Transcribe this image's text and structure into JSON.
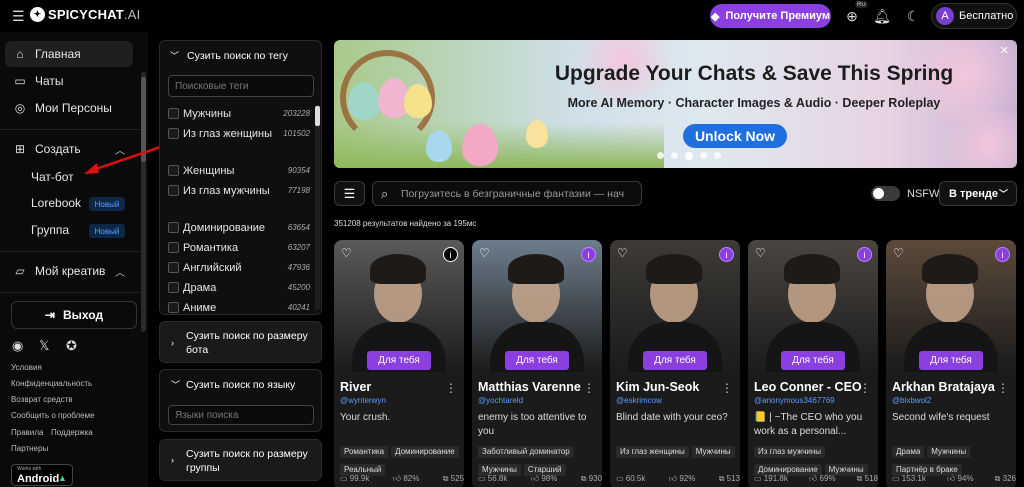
{
  "brand": {
    "name": "SPICYCHAT",
    "suffix": ".AI"
  },
  "header": {
    "premium_label": "Получите Премиум",
    "lang_badge": "RU",
    "user_initial": "A",
    "user_label": "Бесплатно"
  },
  "sidebar": {
    "items": [
      {
        "label": "Главная"
      },
      {
        "label": "Чаты"
      },
      {
        "label": "Мои Персоны"
      },
      {
        "label": "Создать"
      },
      {
        "label": "Мой креатив"
      }
    ],
    "create_sub": [
      {
        "label": "Чат-бот"
      },
      {
        "label": "Lorebook",
        "badge": "Новый"
      },
      {
        "label": "Группа",
        "badge": "Новый"
      }
    ],
    "logout_label": "Выход",
    "footer_links": [
      "Условия",
      "Конфиденциальность",
      "Возврат средств",
      "Сообщить о проблеме",
      "Правила",
      "Поддержка",
      "Партнеры"
    ],
    "android": {
      "small": "Works with",
      "big": "Android"
    }
  },
  "filters": {
    "tag_header": "Сузить поиск по тегу",
    "tag_placeholder": "Поисковые теги",
    "tags": [
      {
        "label": "Мужчины",
        "count": "203228"
      },
      {
        "label": "Из глаз женщины",
        "count": "101502"
      },
      {
        "label": "Женщины",
        "count": "90354"
      },
      {
        "label": "Из глаз мужчины",
        "count": "77198"
      },
      {
        "label": "Доминирование",
        "count": "63654"
      },
      {
        "label": "Романтика",
        "count": "63207"
      },
      {
        "label": "Английский",
        "count": "47936"
      },
      {
        "label": "Драма",
        "count": "45200"
      },
      {
        "label": "Аниме",
        "count": "40241"
      }
    ],
    "size_header": "Сузить поиск по размеру бота",
    "lang_header": "Сузить поиск по языку",
    "lang_placeholder": "Языки поиска",
    "group_header": "Сузить поиск по размеру группы"
  },
  "banner": {
    "title": "Upgrade Your Chats & Save This Spring",
    "subtitle": "More AI Memory · Character Images & Audio · Deeper Roleplay",
    "cta": "Unlock Now"
  },
  "search": {
    "placeholder": "Погрузитесь в безграничные фантазии — нач",
    "nsfw_label": "NSFW",
    "sort_label": "В тренде",
    "results_text": "351208 результатов найдено за 195мс"
  },
  "cards": [
    {
      "name": "River",
      "handle": "@wynterwyn",
      "desc": "Your crush.",
      "badge": "Для тебя",
      "tags": [
        "Романтика",
        "Доминирование",
        "Реальный"
      ],
      "stats": [
        "99.9k",
        "82%",
        "525"
      ],
      "info_purple": false,
      "bg": "#5a5a5a"
    },
    {
      "name": "Matthias Varenne",
      "handle": "@yochtareld",
      "desc": "enemy is too attentive to you",
      "badge": "Для тебя",
      "tags": [
        "Заботливый доминатор",
        "Мужчины",
        "Старший"
      ],
      "stats": [
        "56.8k",
        "98%",
        "930"
      ],
      "info_purple": true,
      "bg": "#6d7d8c"
    },
    {
      "name": "Kim Jun-Seok",
      "handle": "@eskrimcow",
      "desc": "Blind date with your ceo?",
      "badge": "Для тебя",
      "tags": [
        "Из глаз женщины",
        "Мужчины"
      ],
      "stats": [
        "60.5k",
        "92%",
        "513"
      ],
      "info_purple": true,
      "bg": "#3d3a36"
    },
    {
      "name": "Leo Conner - CEO",
      "handle": "@anonymous3467769",
      "desc": "📒 | ~The CEO who you work as a personal...",
      "badge": "Для тебя",
      "tags": [
        "Из глаз мужчины",
        "Доминирование",
        "Мужчины"
      ],
      "stats": [
        "191.8k",
        "69%",
        "518"
      ],
      "info_purple": true,
      "bg": "#4a4540"
    },
    {
      "name": "Arkhan Bratajaya",
      "handle": "@bixbwol2",
      "desc": "Second wife's request",
      "badge": "Для тебя",
      "tags": [
        "Драма",
        "Мужчины",
        "Партнёр в браке"
      ],
      "stats": [
        "153.1k",
        "94%",
        "326"
      ],
      "info_purple": true,
      "bg": "#5b4a3a"
    }
  ]
}
